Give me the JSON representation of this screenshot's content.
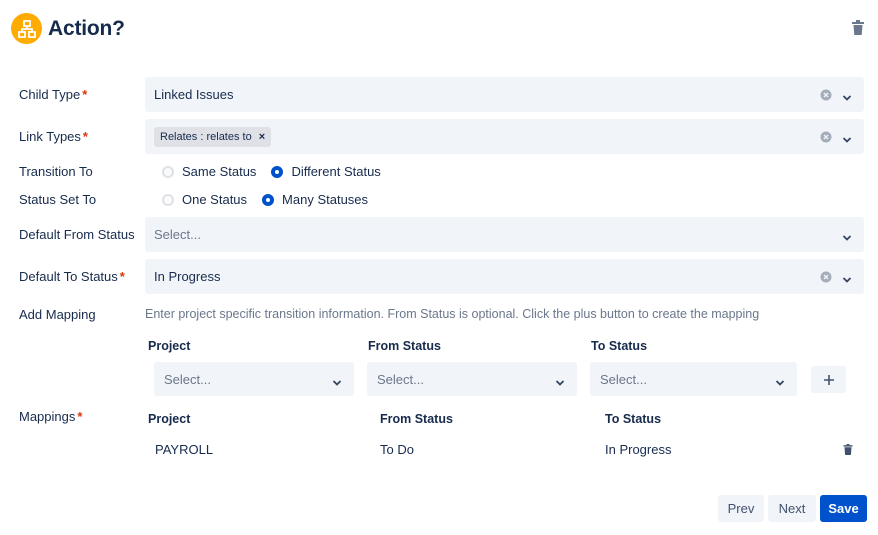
{
  "header": {
    "title": "Action?",
    "icon": "hierarchy-icon",
    "icon_color": "#ffab00"
  },
  "fields": {
    "child_type": {
      "label": "Child Type",
      "required": "*",
      "value": "Linked Issues"
    },
    "link_types": {
      "label": "Link Types",
      "required": "*",
      "tags": [
        "Relates : relates to"
      ],
      "tag_remove": "×"
    },
    "transition_to": {
      "label": "Transition To",
      "options": [
        "Same Status",
        "Different Status"
      ],
      "selected": "Different Status"
    },
    "status_set_to": {
      "label": "Status Set To",
      "options": [
        "One Status",
        "Many Statuses"
      ],
      "selected": "Many Statuses"
    },
    "default_from_status": {
      "label": "Default From Status",
      "placeholder": "Select..."
    },
    "default_to_status": {
      "label": "Default To Status",
      "required": "*",
      "value": "In Progress"
    }
  },
  "add_mapping": {
    "label": "Add Mapping",
    "help": "Enter project specific transition information. From Status is optional. Click the plus button to create the mapping",
    "columns": [
      "Project",
      "From Status",
      "To Status"
    ],
    "placeholders": [
      "Select...",
      "Select...",
      "Select..."
    ],
    "add_icon": "plus-icon"
  },
  "mappings": {
    "label": "Mappings",
    "required": "*",
    "columns": [
      "Project",
      "From Status",
      "To Status"
    ],
    "rows": [
      {
        "project": "PAYROLL",
        "from": "To Do",
        "to": "In Progress"
      }
    ]
  },
  "footer": {
    "prev": "Prev",
    "next": "Next",
    "save": "Save"
  },
  "colors": {
    "accent": "#0052cc",
    "required": "#de350b",
    "field_bg": "#f1f4f8"
  }
}
